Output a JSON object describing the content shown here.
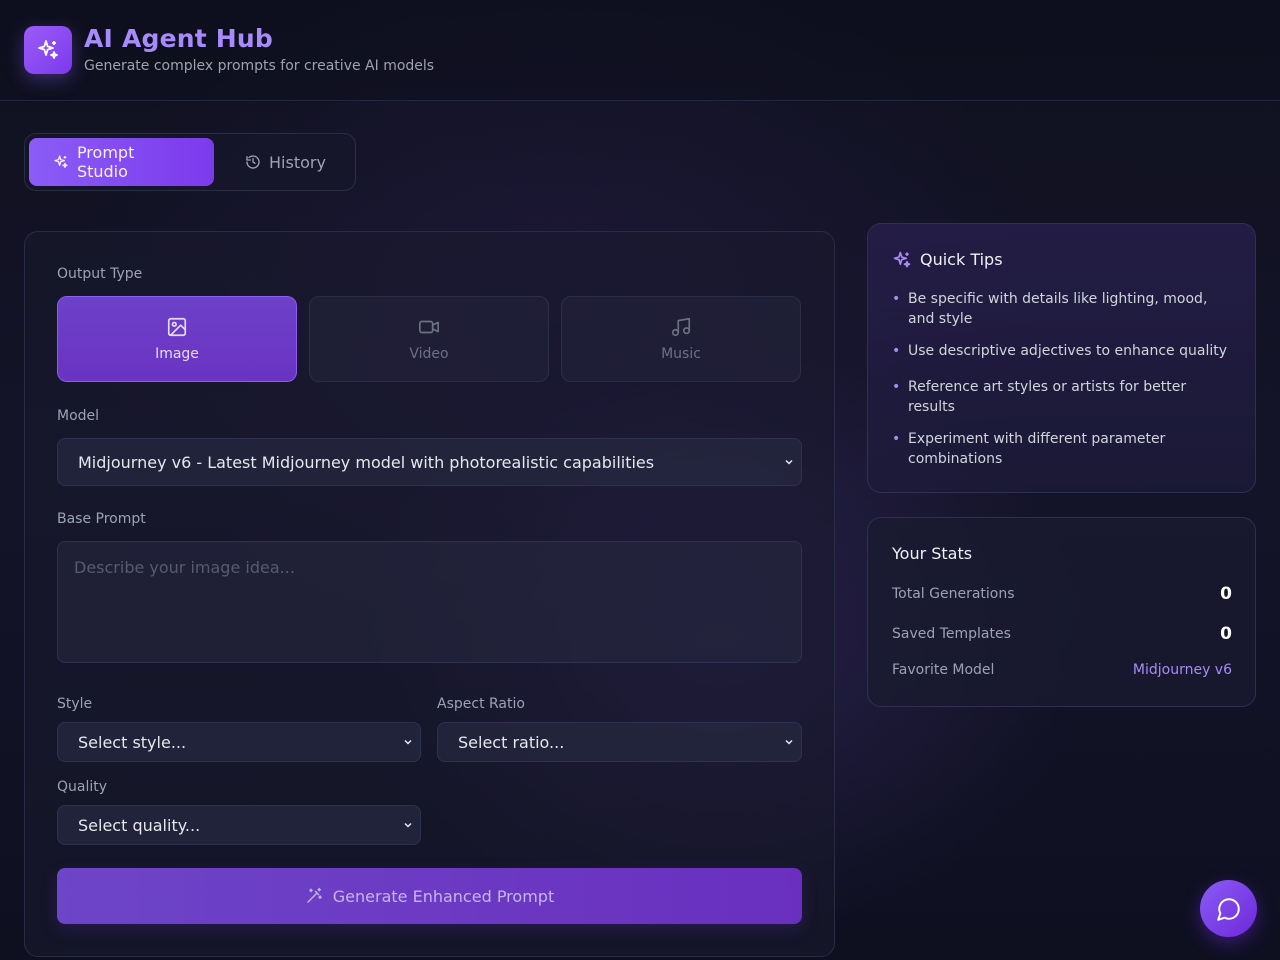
{
  "header": {
    "title": "AI Agent Hub",
    "subtitle": "Generate complex prompts for creative AI models",
    "logo_icon": "sparkles-icon"
  },
  "tabs": [
    {
      "label": "Prompt Studio",
      "icon": "sparkles-icon",
      "active": true
    },
    {
      "label": "History",
      "icon": "history-icon",
      "active": false
    }
  ],
  "form": {
    "output_type_label": "Output Type",
    "output_types": [
      {
        "label": "Image",
        "icon": "image-icon",
        "selected": true
      },
      {
        "label": "Video",
        "icon": "video-icon",
        "selected": false
      },
      {
        "label": "Music",
        "icon": "music-icon",
        "selected": false
      }
    ],
    "model_label": "Model",
    "model_value": "Midjourney v6 - Latest Midjourney model with photorealistic capabilities",
    "base_prompt_label": "Base Prompt",
    "base_prompt_placeholder": "Describe your image idea...",
    "style_label": "Style",
    "style_value": "Select style...",
    "aspect_label": "Aspect Ratio",
    "aspect_value": "Select ratio...",
    "quality_label": "Quality",
    "quality_value": "Select quality...",
    "generate_label": "Generate Enhanced Prompt"
  },
  "tips": {
    "title": "Quick Tips",
    "items": [
      "Be specific with details like lighting, mood, and style",
      "Use descriptive adjectives to enhance quality",
      "Reference art styles or artists for better results",
      "Experiment with different parameter combinations"
    ]
  },
  "stats": {
    "title": "Your Stats",
    "total_label": "Total Generations",
    "total_value": "0",
    "saved_label": "Saved Templates",
    "saved_value": "0",
    "favorite_label": "Favorite Model",
    "favorite_value": "Midjourney v6"
  },
  "colors": {
    "accent": "#8b5cf6",
    "accent_light": "#a78bfa",
    "background": "#12132a"
  }
}
